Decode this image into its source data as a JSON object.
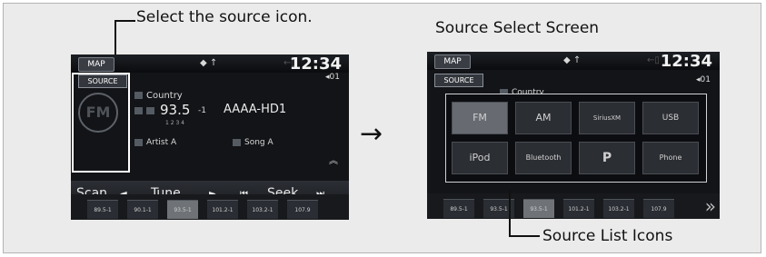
{
  "callouts": {
    "select_source": "Select the source icon.",
    "screen_title": "Source Select Screen",
    "source_list": "Source List Icons"
  },
  "arrow": "→",
  "status_bar": {
    "map_label": "MAP",
    "time": "12:34",
    "channel": "01",
    "icons": "◆ ↑",
    "dim_icon": "←▯"
  },
  "left_screen": {
    "source_label": "SOURCE",
    "fm_label": "FM",
    "genre": "Country",
    "frequency": "93.5",
    "subchannel": "-1",
    "station_name": "AAAA-HD1",
    "hd_channels": "1 2 3 4",
    "artist": "Artist A",
    "song": "Song A",
    "controls": [
      "Scan",
      "◄",
      "Tune",
      "►",
      "⏮",
      "Seek",
      "⏭"
    ],
    "presets": [
      "89.5-1",
      "90.1-1",
      "93.5-1",
      "101.2-1",
      "103.2-1",
      "107.9"
    ],
    "active_preset_index": 2
  },
  "right_screen": {
    "source_label": "SOURCE",
    "genre": "Country",
    "source_icons": [
      {
        "label": "FM",
        "icon": "fm-icon",
        "active": true
      },
      {
        "label": "AM",
        "icon": "am-icon",
        "active": false
      },
      {
        "label": "SiriusXM",
        "icon": "siriusxm-icon",
        "active": false
      },
      {
        "label": "USB",
        "icon": "usb-icon",
        "active": false
      },
      {
        "label": "iPod",
        "icon": "ipod-icon",
        "active": false
      },
      {
        "label": "Bluetooth",
        "icon": "bluetooth-icon",
        "active": false
      },
      {
        "label": "P",
        "icon": "pandora-icon",
        "active": false
      },
      {
        "label": "Phone",
        "icon": "phone-icon",
        "active": false
      }
    ],
    "presets": [
      "89.5-1",
      "93.5-1",
      "93.5-1",
      "101.2-1",
      "103.2-1",
      "107.9"
    ],
    "active_preset_index": 2
  },
  "colors": {
    "panel_bg": "#ebebeb",
    "screen_bg": "#121417",
    "highlight": "#ffffff"
  }
}
